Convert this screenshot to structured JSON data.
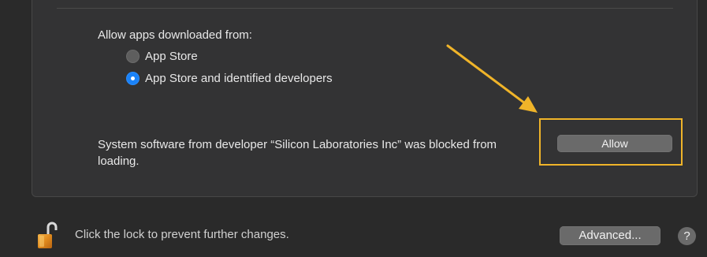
{
  "security": {
    "allow_from_label": "Allow apps downloaded from:",
    "options": [
      {
        "label": "App Store",
        "selected": false
      },
      {
        "label": "App Store and identified developers",
        "selected": true
      }
    ],
    "blocked_message": "System software from developer “Silicon Laboratories Inc” was blocked from loading.",
    "allow_button_label": "Allow"
  },
  "footer": {
    "lock_text": "Click the lock to prevent further changes.",
    "advanced_button_label": "Advanced...",
    "help_label": "?"
  },
  "annotation": {
    "arrow_color": "#f0b429",
    "highlight_color": "#f0b429"
  },
  "icons": {
    "lock": "unlocked-padlock-icon",
    "radio_off": "radio-unselected-icon",
    "radio_on": "radio-selected-icon"
  }
}
